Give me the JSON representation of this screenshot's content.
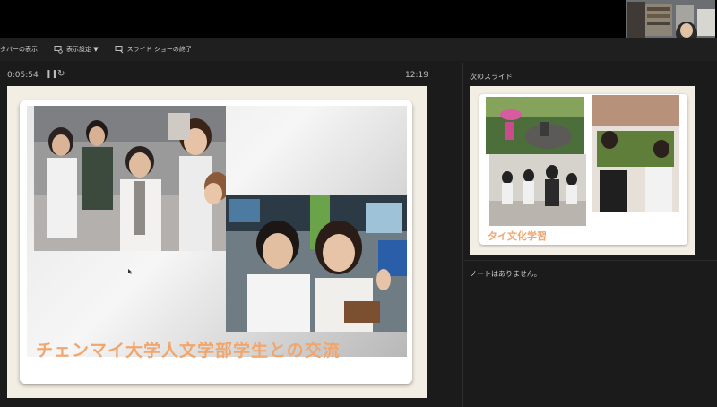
{
  "toolbar": {
    "items": [
      {
        "label": "タバーの表示",
        "icon": "taskbar-icon"
      },
      {
        "label": "表示設定 ▼",
        "icon": "display-settings-icon"
      },
      {
        "label": "スライド ショーの終了",
        "icon": "end-slideshow-icon"
      }
    ]
  },
  "presenter": {
    "elapsed": "0:05:54",
    "clock": "12:19",
    "next_slide_label": "次のスライド",
    "notes": "ノートはありません。"
  },
  "current_slide": {
    "title": "チェンマイ大学人文学部学生との交流",
    "accent_color": "#f0a66d"
  },
  "next_slide": {
    "title": "タイ文化学習"
  },
  "colors": {
    "background": "#1b1b1b",
    "frame": "#f3eee4",
    "accent": "#f0a66d"
  }
}
